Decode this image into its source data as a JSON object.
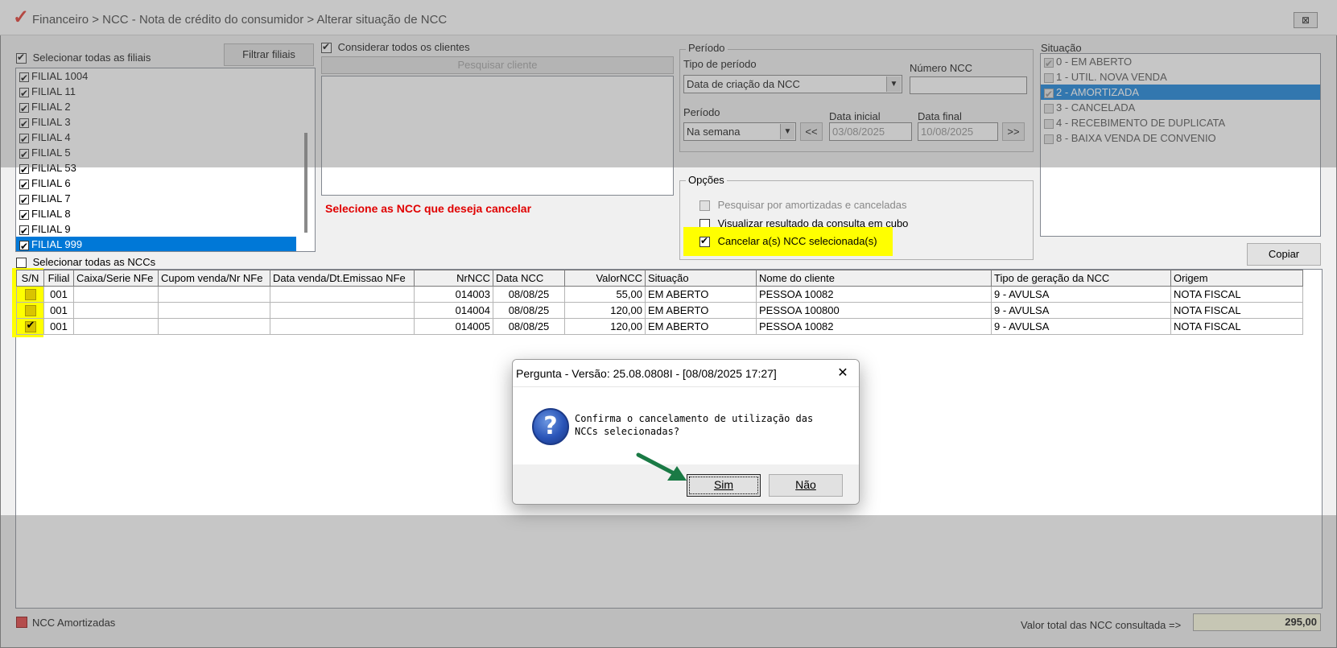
{
  "window": {
    "title": "Financeiro > NCC - Nota de crédito do consumidor > Alterar situação de NCC",
    "close_label": "⊠"
  },
  "filiais": {
    "select_all_label": "Selecionar todas as filiais",
    "filter_button": "Filtrar filiais",
    "items": [
      "FILIAL 1004",
      "FILIAL 11",
      "FILIAL 2",
      "FILIAL 3",
      "FILIAL 4",
      "FILIAL 5",
      "FILIAL 53",
      "FILIAL 6",
      "FILIAL 7",
      "FILIAL 8",
      "FILIAL 9",
      "FILIAL 999"
    ]
  },
  "clientes": {
    "consider_all_label": "Considerar todos os clientes",
    "search_button": "Pesquisar cliente",
    "instruction": "Selecione as NCC que deseja cancelar"
  },
  "periodo": {
    "group_title": "Período",
    "tipo_label": "Tipo de período",
    "tipo_value": "Data de criação da NCC",
    "numero_label": "Número NCC",
    "numero_value": "",
    "periodo_label": "Período",
    "periodo_value": "Na semana",
    "prev_button": "<<",
    "next_button": ">>",
    "data_inicial_label": "Data inicial",
    "data_inicial_value": "03/08/2025",
    "data_final_label": "Data final",
    "data_final_value": "10/08/2025"
  },
  "situacao": {
    "group_title": "Situação",
    "items": [
      "0 - EM ABERTO",
      "1 - UTIL. NOVA VENDA",
      "2 - AMORTIZADA",
      "3 - CANCELADA",
      "4 - RECEBIMENTO DE DUPLICATA",
      "8 - BAIXA VENDA DE CONVENIO"
    ]
  },
  "opcoes": {
    "group_title": "Opções",
    "opt1": "Pesquisar por amortizadas e canceladas",
    "opt2": "Visualizar resultado da consulta em cubo",
    "opt3": "Cancelar a(s) NCC selecionada(s)"
  },
  "grid": {
    "select_all_label": "Selecionar todas as NCCs",
    "copy_button": "Copiar",
    "columns": [
      "S/N",
      "Filial",
      "Caixa/Serie NFe",
      "Cupom venda/Nr NFe",
      "Data venda/Dt.Emissao NFe",
      "NrNCC",
      "Data NCC",
      "ValorNCC",
      "Situação",
      "Nome do cliente",
      "Tipo de geração da NCC",
      "Origem"
    ],
    "rows": [
      {
        "filial": "001",
        "caixa": "",
        "cupom": "",
        "data_venda": "",
        "nr": "014003",
        "data": "08/08/25",
        "valor": "55,00",
        "situacao": "EM ABERTO",
        "cliente": "PESSOA 10082",
        "tipo": "9 - AVULSA",
        "origem": "NOTA FISCAL"
      },
      {
        "filial": "001",
        "caixa": "",
        "cupom": "",
        "data_venda": "",
        "nr": "014004",
        "data": "08/08/25",
        "valor": "120,00",
        "situacao": "EM ABERTO",
        "cliente": "PESSOA 100800",
        "tipo": "9 - AVULSA",
        "origem": "NOTA FISCAL"
      },
      {
        "filial": "001",
        "caixa": "",
        "cupom": "",
        "data_venda": "",
        "nr": "014005",
        "data": "08/08/25",
        "valor": "120,00",
        "situacao": "EM ABERTO",
        "cliente": "PESSOA 10082",
        "tipo": "9 - AVULSA",
        "origem": "NOTA FISCAL"
      }
    ]
  },
  "footer": {
    "legend_label": "NCC Amortizadas",
    "total_label": "Valor total das NCC consultada =>",
    "total_value": "295,00"
  },
  "dialog": {
    "title": "Pergunta - Versão: 25.08.0808I - [08/08/2025 17:27]",
    "close": "✕",
    "message": "Confirma o cancelamento de utilização das NCCs selecionadas?",
    "yes_button": "Sim",
    "no_button": "Não",
    "icon_glyph": "?"
  },
  "colors": {
    "selection": "#0078d7",
    "highlight": "#ffff00",
    "instruction_red": "#e00000",
    "arrow_green": "#1a7a45",
    "legend_red": "#e03030"
  }
}
